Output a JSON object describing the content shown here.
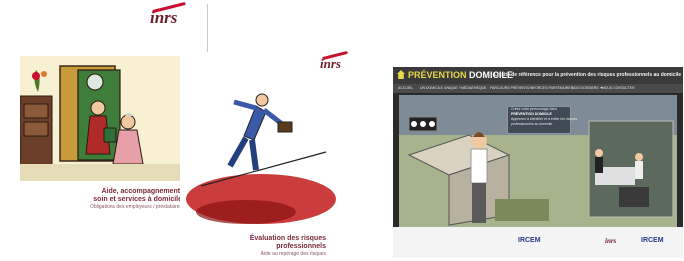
{
  "top_logo": {
    "text": "inrs"
  },
  "doc1": {
    "title_lines": [
      "Aide, accompagnement,",
      "soin et services à domicile"
    ],
    "subtitle": "Obligations des employeurs / prestataires"
  },
  "doc2": {
    "logo": "inrs",
    "title_lines": [
      "Évaluation des risques",
      "professionnels"
    ],
    "subtitle": "Aide au repérage des risques"
  },
  "site": {
    "title_prefix": "PRÉVENTION",
    "title_suffix": "DOMICILE",
    "tagline": "Le site de référence pour la prévention des risques professionnels au domicile",
    "nav": [
      "ACCUEIL",
      "UN DOMICILE UNIQUE ?",
      "MÉDIATHÈQUE",
      "PARCOURS PRÉVENTION",
      "FORCES PARTENAIRES",
      "NOS DOSSIERS ▼",
      "NOUS CONTACTER"
    ],
    "bubble_lines": [
      "Créez votre personnage dans",
      "PRÉVENTION DOMICILE",
      "Apprenez à identifier et à éviter les risques",
      "professionnels au domicile."
    ],
    "footer_logos": [
      "IRCEM",
      "inrs",
      "IRCEM"
    ]
  }
}
